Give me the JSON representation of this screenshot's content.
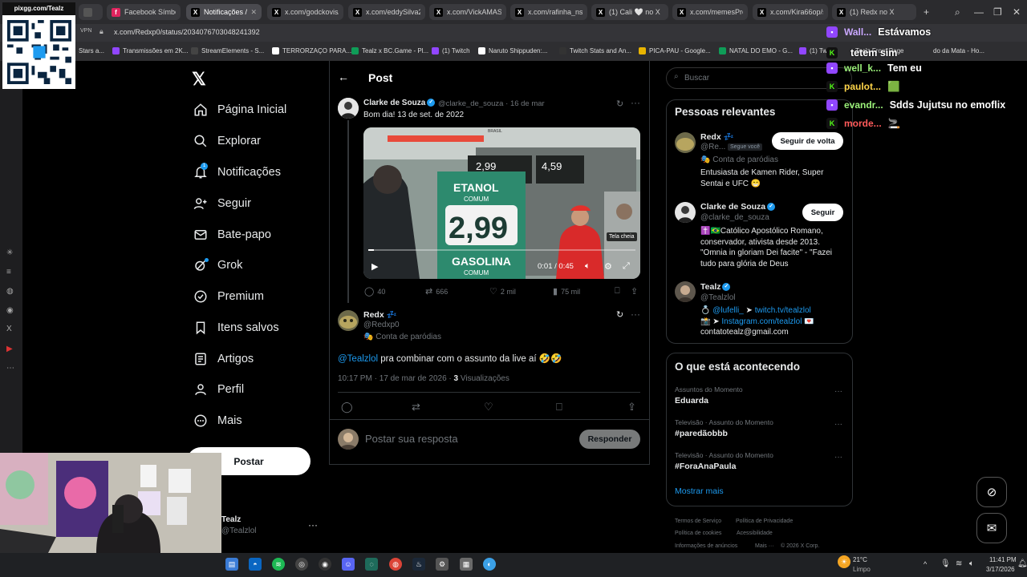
{
  "overlay": {
    "qr_title": "pixgg.com/Tealz"
  },
  "browser": {
    "tabs": [
      {
        "label": "",
        "icon": "blank-tab-icon"
      },
      {
        "label": "Facebook Símbolos",
        "icon": "facebook-icon"
      },
      {
        "label": "Notificações / X",
        "icon": "x-icon"
      },
      {
        "label": "x.com/godckovis/sta",
        "icon": "x-icon"
      },
      {
        "label": "x.com/eddySilva223",
        "icon": "x-icon"
      },
      {
        "label": "x.com/VickAMASSA",
        "icon": "x-icon"
      },
      {
        "label": "x.com/rafinha_nsl/st",
        "icon": "x-icon"
      },
      {
        "label": "(1) Cali 🤍 no X",
        "icon": "x-icon"
      },
      {
        "label": "x.com/memesProTe",
        "icon": "x-icon"
      },
      {
        "label": "x.com/Kira66op/sta",
        "icon": "x-icon"
      },
      {
        "label": "(1) Redx no X",
        "icon": "x-icon"
      }
    ],
    "url": "x.com/Redxp0/status/2034076703048241392",
    "vpn_label": "VPN",
    "bookmarks": [
      {
        "label": "Stars a..."
      },
      {
        "label": "Transmissões em 2K..."
      },
      {
        "label": "StreamElements - S..."
      },
      {
        "label": "TERRORZAÇO PARA..."
      },
      {
        "label": "Tealz x BC.Game - Pl..."
      },
      {
        "label": "(1) Twitch"
      },
      {
        "label": "Naruto Shippuden:..."
      },
      {
        "label": "Twitch Stats and An..."
      },
      {
        "label": "PICA-PAU - Google..."
      },
      {
        "label": "NATAL DO EMO - G..."
      },
      {
        "label": "(1) Twitch"
      },
      {
        "label": "Tealz Front Page"
      },
      {
        "label": "do da Mata - Ho..."
      }
    ]
  },
  "nav": {
    "items": [
      {
        "label": "Página Inicial",
        "icon": "home-icon"
      },
      {
        "label": "Explorar",
        "icon": "search-icon"
      },
      {
        "label": "Notificações",
        "icon": "bell-icon"
      },
      {
        "label": "Seguir",
        "icon": "follow-icon"
      },
      {
        "label": "Bate-papo",
        "icon": "mail-icon"
      },
      {
        "label": "Grok",
        "icon": "grok-icon"
      },
      {
        "label": "Premium",
        "icon": "premium-icon"
      },
      {
        "label": "Itens salvos",
        "icon": "bookmark-icon"
      },
      {
        "label": "Artigos",
        "icon": "article-icon"
      },
      {
        "label": "Perfil",
        "icon": "profile-icon"
      },
      {
        "label": "Mais",
        "icon": "more-icon"
      }
    ],
    "notif_count": "1",
    "post_button": "Postar",
    "account": {
      "name": "Tealz",
      "handle": "@Tealzlol",
      "more": "···"
    }
  },
  "post_header": {
    "title": "Post"
  },
  "quoted": {
    "name": "Clarke de Souza",
    "handle": "@clarke_de_souza",
    "date": "16 de mar",
    "text": "Bom dia! 13 de set. de 2022",
    "video": {
      "current": "0:01",
      "total": "0:45",
      "progress": 0.02,
      "tooltip": "Tela cheia",
      "sign_top": "ETANOL",
      "sign_sub": "COMUM",
      "sign_price": "2,99",
      "sign_bottom": "GASOLINA",
      "sign_bottom_sub": "COMUM",
      "pump_left": "2,99",
      "pump_right": "4,59",
      "banner_small": "BRASIL"
    },
    "stats": {
      "replies": "40",
      "reposts": "666",
      "likes": "2 mil",
      "views": "75 mil"
    }
  },
  "reply_post": {
    "name": "Redx",
    "name_suffix": "💤",
    "handle": "@Redxp0",
    "parody_label": "Conta de paródias",
    "mention": "@Tealzlol",
    "text": " pra combinar com o assunto da live aí 🤣🤣",
    "time": "10:17 PM · 17 de mar de 2026 · ",
    "views_count": "3",
    "views_label": " Visualizações"
  },
  "reply_box": {
    "placeholder": "Postar sua resposta",
    "button": "Responder"
  },
  "right": {
    "search_placeholder": "Buscar",
    "relevant": {
      "title": "Pessoas relevantes",
      "people": [
        {
          "name": "Redx 💤",
          "handle": "@Re...",
          "follows_you": "Segue você",
          "parody": "Conta de paródias",
          "bio": "Entusiasta de Kamen Rider, Super Sentai e UFC 😁",
          "button": "Seguir de volta"
        },
        {
          "name": "Clarke de Souza",
          "handle": "@clarke_de_souza",
          "bio": "✝️🇧🇷Católico Apostólico Romano, conservador, ativista desde 2013. \"Omnia in gloriam Dei facite\" - \"Fazei tudo para glória de Deus",
          "button": "Seguir"
        },
        {
          "name": "Tealz",
          "handle": "@Tealzlol",
          "bio_line1": "➤ ",
          "bio_link1": "twitch.tv/tealzlol",
          "bio_line1_prefix": "💍 ",
          "bio_mention": "@lufelli_",
          "bio_line2_prefix": "📸 ➤ ",
          "bio_link2": "Instagram.com/tealzlol",
          "bio_line2_suffix": " 💌",
          "bio_line3": "contatotealz@gmail.com"
        }
      ]
    },
    "trends": {
      "title": "O que está acontecendo",
      "items": [
        {
          "category": "Assuntos do Momento",
          "title": "Eduarda"
        },
        {
          "category": "Televisão · Assunto do Momento",
          "title": "#paredãobbb"
        },
        {
          "category": "Televisão · Assunto do Momento",
          "title": "#ForaAnaPaula"
        }
      ],
      "show_more": "Mostrar mais"
    },
    "footer": [
      "Termos de Serviço",
      "Política de Privacidade",
      "Política de cookies",
      "Acessibilidade",
      "Informações de anúncios",
      "Mais ···",
      "© 2026 X Corp."
    ]
  },
  "chat": [
    {
      "user": "Wall...",
      "msg": "Estávamos",
      "platform": "twitch",
      "color": "#c9a7ff"
    },
    {
      "user": "",
      "msg": "tetem sim",
      "platform": "kick",
      "color": "#ffffff"
    },
    {
      "user": "well_k...",
      "msg": "Tem eu",
      "platform": "twitch",
      "color": "#9cf27a"
    },
    {
      "user": "paulot...",
      "msg": "🟩",
      "platform": "kick",
      "color": "#ffd54a"
    },
    {
      "user": "evandr...",
      "msg": "Sdds Jujutsu no emoflix",
      "platform": "twitch",
      "color": "#9cf27a"
    },
    {
      "user": "morde...",
      "msg": "🚬",
      "platform": "kick",
      "color": "#ff5a5a"
    }
  ],
  "taskbar": {
    "weather_temp": "21°C",
    "weather_desc": "Limpo",
    "time": "11:41 PM",
    "date": "3/17/2026"
  },
  "colors": {
    "accent": "#1d9bf0",
    "bg": "#000000",
    "muted": "#71767b",
    "text": "#e7e9ea"
  }
}
